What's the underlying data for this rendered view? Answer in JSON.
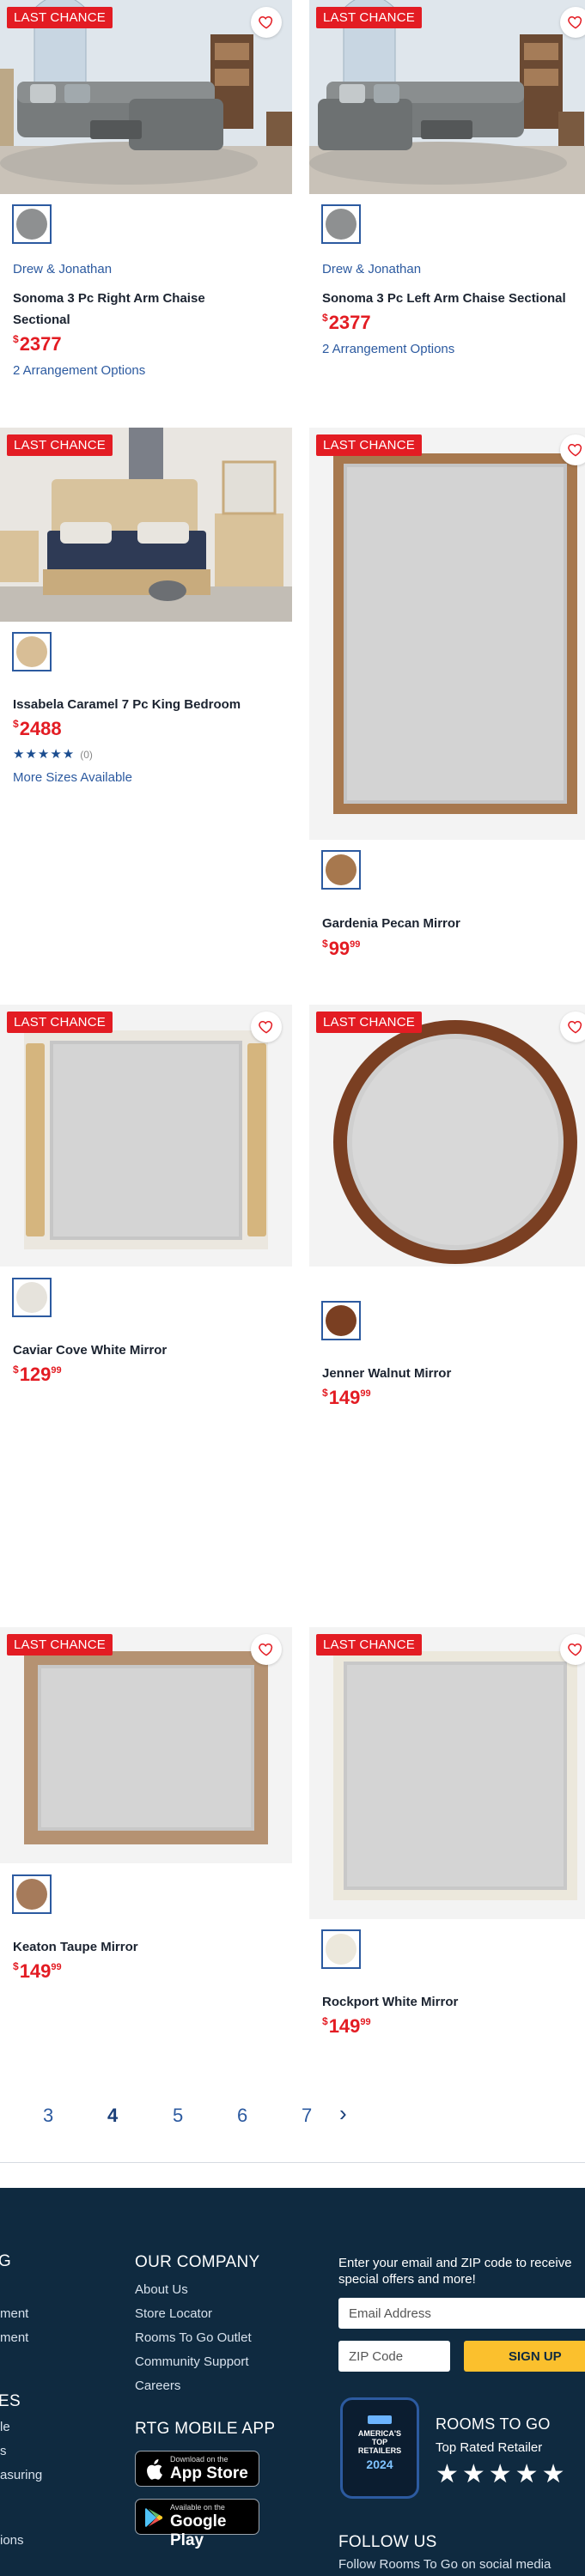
{
  "products": [
    {
      "badge": "LAST CHANCE",
      "brand": "Drew & Jonathan",
      "name_line1": "Sonoma 3 Pc Right Arm Chaise",
      "name_line2": "Sectional",
      "price": "2377",
      "currency": "$",
      "options": "2 Arrangement Options"
    },
    {
      "badge": "LAST CHANCE",
      "brand": "Drew & Jonathan",
      "name_line1": "Sonoma 3 Pc Left Arm Chaise Sectional",
      "price": "2377",
      "currency": "$",
      "options": "2 Arrangement Options"
    },
    {
      "badge": "LAST CHANCE",
      "name_line1": "Issabela Caramel 7 Pc King Bedroom",
      "price": "2488",
      "currency": "$",
      "stars": "★★★★★",
      "review_count": "(0)",
      "options": "More Sizes Available"
    },
    {
      "badge": "LAST CHANCE",
      "name_line1": "Gardenia Pecan Mirror",
      "price": "99",
      "cents": "99",
      "currency": "$"
    },
    {
      "badge": "LAST CHANCE",
      "name_line1": "Caviar Cove White Mirror",
      "price": "129",
      "cents": "99",
      "currency": "$"
    },
    {
      "badge": "LAST CHANCE",
      "name_line1": "Jenner Walnut Mirror",
      "price": "149",
      "cents": "99",
      "currency": "$"
    },
    {
      "badge": "LAST CHANCE",
      "name_line1": "Keaton Taupe Mirror",
      "price": "149",
      "cents": "99",
      "currency": "$"
    },
    {
      "badge": "LAST CHANCE",
      "name_line1": "Rockport White Mirror",
      "price": "149",
      "cents": "99",
      "currency": "$"
    }
  ],
  "pagination": {
    "pages": [
      "3",
      "4",
      "5",
      "6",
      "7"
    ],
    "current": "4",
    "next": "›"
  },
  "footer": {
    "left_col": {
      "heading_frag": "G",
      "items": [
        "ment",
        "ment"
      ],
      "heading2_frag": "ES",
      "items2": [
        "le",
        "s",
        "asuring"
      ],
      "items3": [
        "ions"
      ]
    },
    "company": {
      "heading": "OUR COMPANY",
      "links": [
        "About Us",
        "Store Locator",
        "Rooms To Go Outlet",
        "Community Support",
        "Careers"
      ]
    },
    "mobile": {
      "heading": "RTG MOBILE APP",
      "app_store_small": "Download on the",
      "app_store_big": "App Store",
      "google_small": "Available on the",
      "google_big": "Google Play"
    },
    "newsletter": {
      "text_line1": "Enter your email and ZIP code to receive",
      "text_line2": "special offers and more!",
      "email_placeholder": "Email Address",
      "zip_placeholder": "ZIP Code",
      "signup_label": "SIGN UP"
    },
    "award": {
      "badge_line1": "AMERICA'S",
      "badge_line2": "TOP",
      "badge_line3": "RETAILERS",
      "badge_year": "2024",
      "title": "ROOMS TO GO",
      "subtitle": "Top Rated Retailer",
      "stars": "★★★★★"
    },
    "follow": {
      "heading": "FOLLOW US",
      "text": "Follow Rooms To Go on social media"
    }
  },
  "colors": {
    "accent_red": "#e31c23",
    "link_blue": "#2c5aa0",
    "footer_bg": "#0f2a40",
    "signup_yellow": "#fbc02d"
  }
}
